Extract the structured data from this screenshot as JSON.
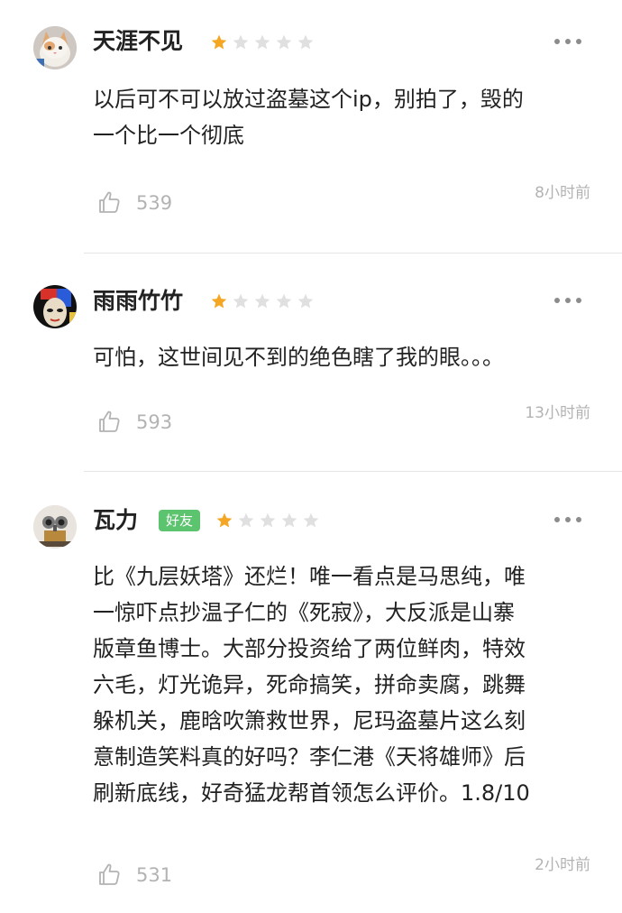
{
  "colors": {
    "star_filled": "#f5a623",
    "star_empty": "#e0e0e0",
    "friend_badge": "#5cc36e",
    "meta_text": "#b3b3b3"
  },
  "reviews": [
    {
      "username": "天涯不见",
      "friend_badge": "",
      "rating": 1,
      "rating_max": 5,
      "content": "以后可不可以放过盗墓这个ip，别拍了，毁的\n一个比一个彻底",
      "likes": "539",
      "time": "8小时前",
      "avatar_icon": "kitten-avatar-icon"
    },
    {
      "username": "雨雨竹竹",
      "friend_badge": "",
      "rating": 1,
      "rating_max": 5,
      "content": "可怕，这世间见不到的绝色瞎了我的眼。。。",
      "likes": "593",
      "time": "13小时前",
      "avatar_icon": "portrait-avatar-icon"
    },
    {
      "username": "瓦力",
      "friend_badge": "好友",
      "rating": 1,
      "rating_max": 5,
      "content": "比《九层妖塔》还烂！唯一看点是马思纯，唯\n一惊吓点抄温子仁的《死寂》，大反派是山寨\n版章鱼博士。大部分投资给了两位鲜肉，特效\n六毛，灯光诡异，死命搞笑，拼命卖腐，跳舞\n躲机关，鹿晗吹箫救世界，尼玛盗墓片这么刻\n意制造笑料真的好吗？李仁港《天将雄师》后\n刷新底线，好奇猛龙帮首领怎么评价。1.8/10",
      "likes": "531",
      "time": "2小时前",
      "avatar_icon": "robot-avatar-icon"
    }
  ]
}
